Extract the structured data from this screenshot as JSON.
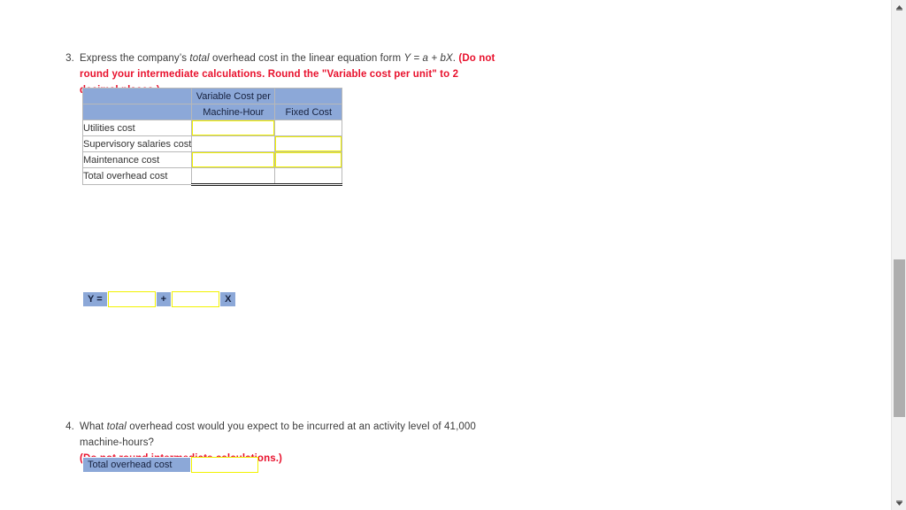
{
  "questions": [
    {
      "number": "3.",
      "text_part1": "Express the company’s ",
      "text_italic1": "total",
      "text_part2": " overhead cost in the linear equation form ",
      "formula": "Y = a + bX",
      "text_part3": ". ",
      "instruction": "(Do not round your intermediate calculations. Round the \"Variable cost per unit\" to 2 decimal places.)"
    },
    {
      "number": "4.",
      "text_part1": "What ",
      "text_italic1": "total",
      "text_part2": " overhead cost would you expect to be incurred at an activity level of 41,000 machine-hours?",
      "instruction": "(Do not round intermediate calculations.)"
    }
  ],
  "cost_table": {
    "header_row1": {
      "blank_label": "",
      "variable_cost_top": "Variable Cost per",
      "fixed_cost_blank": ""
    },
    "header_row2": {
      "blank_label": "",
      "variable_cost_bottom": "Machine-Hour",
      "fixed_cost": "Fixed Cost"
    },
    "rows": [
      {
        "label": "Utilities cost",
        "variable_value": "",
        "fixed_value": "",
        "variable_editable": true,
        "fixed_editable": false
      },
      {
        "label": "Supervisory salaries cost",
        "variable_value": "",
        "fixed_value": "",
        "variable_editable": false,
        "fixed_editable": true
      },
      {
        "label": "Maintenance cost",
        "variable_value": "",
        "fixed_value": "",
        "variable_editable": true,
        "fixed_editable": true
      },
      {
        "label": "Total overhead cost",
        "variable_value": "",
        "fixed_value": "",
        "variable_editable": false,
        "fixed_editable": false
      }
    ]
  },
  "equation": {
    "y_label": "Y =",
    "intercept_value": "",
    "plus_label": "+",
    "slope_value": "",
    "x_label": "X"
  },
  "final_answer": {
    "label": "Total overhead cost",
    "value": ""
  },
  "scrollbar": {
    "up_arrow": "scroll-up-arrow",
    "down_arrow": "scroll-down-arrow",
    "thumb": "scroll-thumb"
  },
  "colors": {
    "header_blue": "#8ca8d8",
    "entry_yellow": "#f2f200",
    "instruction_red": "#e8112d",
    "body_text": "#3a3a3a",
    "scroll_thumb": "#aeaeae",
    "scroll_track": "#f1f1f1"
  }
}
